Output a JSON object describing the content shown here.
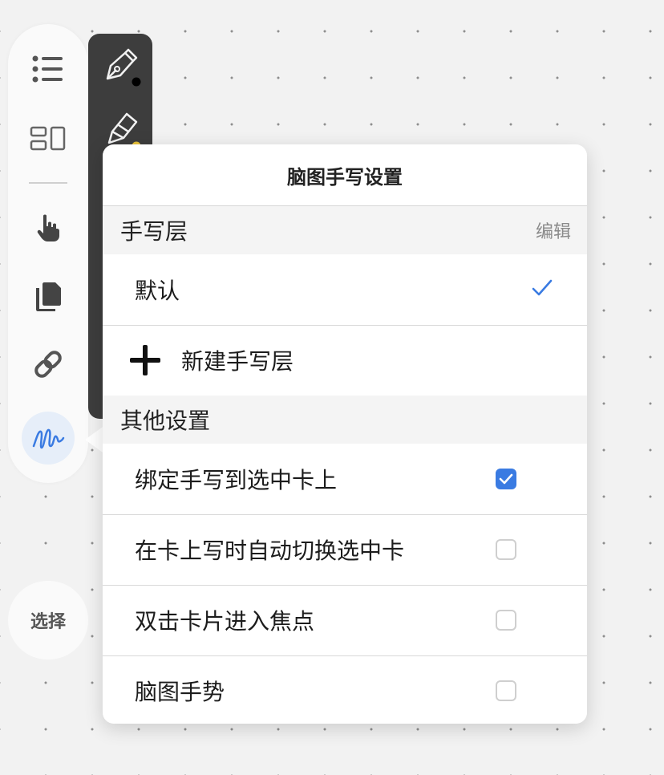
{
  "popover": {
    "title": "脑图手写设置",
    "layers_section": {
      "title": "手写层",
      "edit_label": "编辑"
    },
    "layers": [
      {
        "label": "默认",
        "selected": true
      }
    ],
    "new_layer_label": "新建手写层",
    "other_section": {
      "title": "其他设置"
    },
    "settings": [
      {
        "label": "绑定手写到选中卡上",
        "checked": true
      },
      {
        "label": "在卡上写时自动切换选中卡",
        "checked": false
      },
      {
        "label": "双击卡片进入焦点",
        "checked": false
      },
      {
        "label": "脑图手势",
        "checked": false
      }
    ]
  },
  "left_toolbar": {
    "icons": [
      "list-icon",
      "layout-icon",
      "hand-pointer-icon",
      "copy-icon",
      "link-icon",
      "handwriting-icon"
    ],
    "active": "handwriting-icon",
    "select_button_label": "选择"
  },
  "pen_toolbar": {
    "tools": [
      {
        "icon": "pen-icon",
        "color": "#000000"
      },
      {
        "icon": "highlighter-icon",
        "color": "#e8c23a"
      }
    ]
  },
  "colors": {
    "accent": "#3a7be2",
    "popover_bg": "#ffffff",
    "pen_bar_bg": "#3d3d3d",
    "canvas_bg": "#f2f2f2"
  }
}
